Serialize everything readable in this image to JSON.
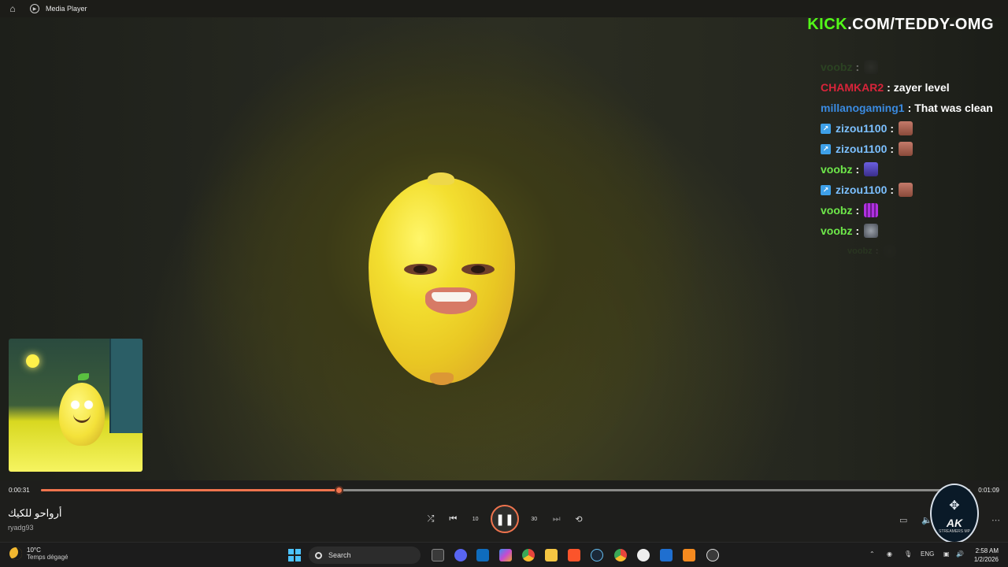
{
  "window": {
    "title": "Media Player"
  },
  "overlay": {
    "kick_logo": "KICK",
    "kick_url": ".COM/TEDDY-OMG",
    "chat": [
      {
        "user": "voobz",
        "message": "",
        "emote": "emote-bird",
        "user_color": "#3a7a2a",
        "faded": true
      },
      {
        "user": "CHAMKAR2",
        "message": "zayer level",
        "emote": "",
        "user_color": "#d8243a"
      },
      {
        "user": "millanogaming1",
        "message": "That was clean",
        "emote": "",
        "user_color": "#3a8ae0"
      },
      {
        "user": "zizou1100",
        "message": "",
        "emote": "emote-face",
        "user_color": "#7cc0ff",
        "badge": true
      },
      {
        "user": "zizou1100",
        "message": "",
        "emote": "emote-face",
        "user_color": "#7cc0ff",
        "badge": true
      },
      {
        "user": "voobz",
        "message": "",
        "emote": "emote-char",
        "user_color": "#6ee84a"
      },
      {
        "user": "zizou1100",
        "message": "",
        "emote": "emote-face",
        "user_color": "#7cc0ff",
        "badge": true
      },
      {
        "user": "voobz",
        "message": "",
        "emote": "emote-purple",
        "user_color": "#6ee84a"
      },
      {
        "user": "voobz",
        "message": "",
        "emote": "emote-rat",
        "user_color": "#6ee84a"
      },
      {
        "user": "voobz",
        "message": "",
        "emote": "emote-bird",
        "user_color": "#6ee84a",
        "ghost": true
      }
    ]
  },
  "player": {
    "current_time": "0:00:31",
    "duration": "0:01:09",
    "progress": 0.32,
    "track_title": "أرواحو للكيك",
    "track_artist": "ryadg93",
    "controls": {
      "shuffle": "shuffle-icon",
      "previous": "previous-icon",
      "rewind": "10",
      "play_pause": "pause-icon",
      "forward": "30",
      "next": "next-icon",
      "repeat": "repeat-off-icon"
    },
    "logo": {
      "text": "AK",
      "sub": "STREAMERS MP"
    }
  },
  "taskbar": {
    "weather_temp": "10°C",
    "weather_desc": "Temps dégagé",
    "search_placeholder": "Search",
    "language": "ENG",
    "time": "2:58 AM",
    "date": "1/2/2026"
  },
  "colors": {
    "accent": "#f0744e",
    "kick_green": "#53fc18"
  }
}
